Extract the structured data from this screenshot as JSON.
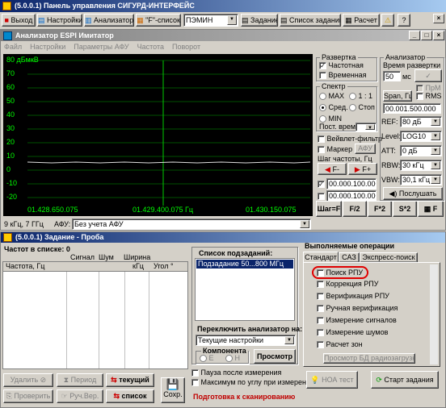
{
  "main_window": {
    "title": "(5.0.0.1) Панель управления СИГУРД-ИНТЕРФЕЙС",
    "toolbar": {
      "exit": "Выход",
      "settings": "Настройки",
      "analyzer": "Анализатор",
      "f_list": "\"F\"-список",
      "preset": "ПЭМИН",
      "task": "Задание",
      "task_list": "Список заданий",
      "calc": "Расчет"
    }
  },
  "analyzer": {
    "title": "Анализатор ESPI Имитатор",
    "menu": [
      "Файл",
      "Настройки",
      "Параметры АФУ",
      "Частота",
      "Поворот"
    ],
    "plot": {
      "y_ticks": [
        "80 дБмкВ",
        "70",
        "60",
        "50",
        "40",
        "30",
        "20",
        "10",
        "0",
        "-10",
        "-20"
      ],
      "x_left": "01.428.650.075",
      "x_center": "01.429.400.075 Гц",
      "x_right": "01.430.150.075"
    },
    "sweep": {
      "label": "Развертка",
      "frequency": "Частотная",
      "time": "Временная"
    },
    "spectrum": {
      "label": "Спектр",
      "max": "MAX",
      "ratio": "1 : 1",
      "avg": "Сред.",
      "stop": "Стоп",
      "min": "MIN",
      "const_time": "Пост. врем."
    },
    "wavelet": "Вейвлет-фильтр",
    "marker": "Маркер",
    "afu": "АФУ",
    "freq_step": "Шаг частоты, Гц",
    "f_minus": "F-",
    "f_plus": "F+",
    "freq1": "00.000.100.000",
    "freq2": "00.000.100.000",
    "bottom_buttons": [
      "Шаг=F",
      "F/2",
      "F*2",
      "S*2"
    ],
    "f_btn": "F",
    "rbw_step": "9 кГц, 7 ГГц",
    "afu_label": "АФУ:",
    "afu_value": "Без учета АФУ",
    "panel": {
      "label": "Анализатор",
      "sweep_time": "Время развертки",
      "sweep_val": "50",
      "ms": "мс",
      "prm": "ПрМ",
      "rms": "RMS",
      "span": "Span, Гц",
      "span_val": "00.001.500.000",
      "ref": "REF:",
      "ref_val": "80 дБ",
      "level": "Level:",
      "level_val": "LOG10",
      "att": "ATT:",
      "att_val": "0 дБ",
      "rbw": "RBW:",
      "rbw_val": "30 кГц",
      "vbw": "VBW:",
      "vbw_val": "30,1 кГц",
      "listen": "Послушать"
    }
  },
  "task_window": {
    "title": "(5.0.0.1) Задание - Проба",
    "freq_count": "Частот в списке: 0",
    "cols_top": [
      "Сигнал",
      "Шум",
      "Ширина"
    ],
    "cols": [
      "Частота, Гц",
      "кГц",
      "Угол °"
    ],
    "btn_delete": "Удалить",
    "btn_period": "Период",
    "btn_current": "текущий",
    "btn_check": "Проверить",
    "btn_manual": "Руч.Вер.",
    "btn_list": "список",
    "btn_save": "Сохр.",
    "subtasks": {
      "label": "Список подзаданий:",
      "item": "Подзадание 50...800 МГц"
    },
    "switch": {
      "label": "Переключить анализатор на:",
      "value": "Текущие настройки",
      "component": "Компонента",
      "e": "E",
      "h": "H",
      "view": "Просмотр"
    },
    "pause": "Пауза после измерения",
    "max_angle": "Максимум по углу при измерении",
    "status": "Подготовка к сканированию",
    "ops": {
      "label": "Выполняемые операции",
      "tabs": [
        "Стандарт",
        "САЗ",
        "Экспресс-поиск"
      ],
      "items": [
        "Поиск РПУ",
        "Коррекция РПУ",
        "Верификация РПУ",
        "Ручная верификация",
        "Измерение сигналов",
        "Измерение шумов",
        "Расчет зон"
      ],
      "view_db": "Просмотр БД радиозагрузки",
      "noa": "НОА тест",
      "start": "Старт задания"
    }
  }
}
